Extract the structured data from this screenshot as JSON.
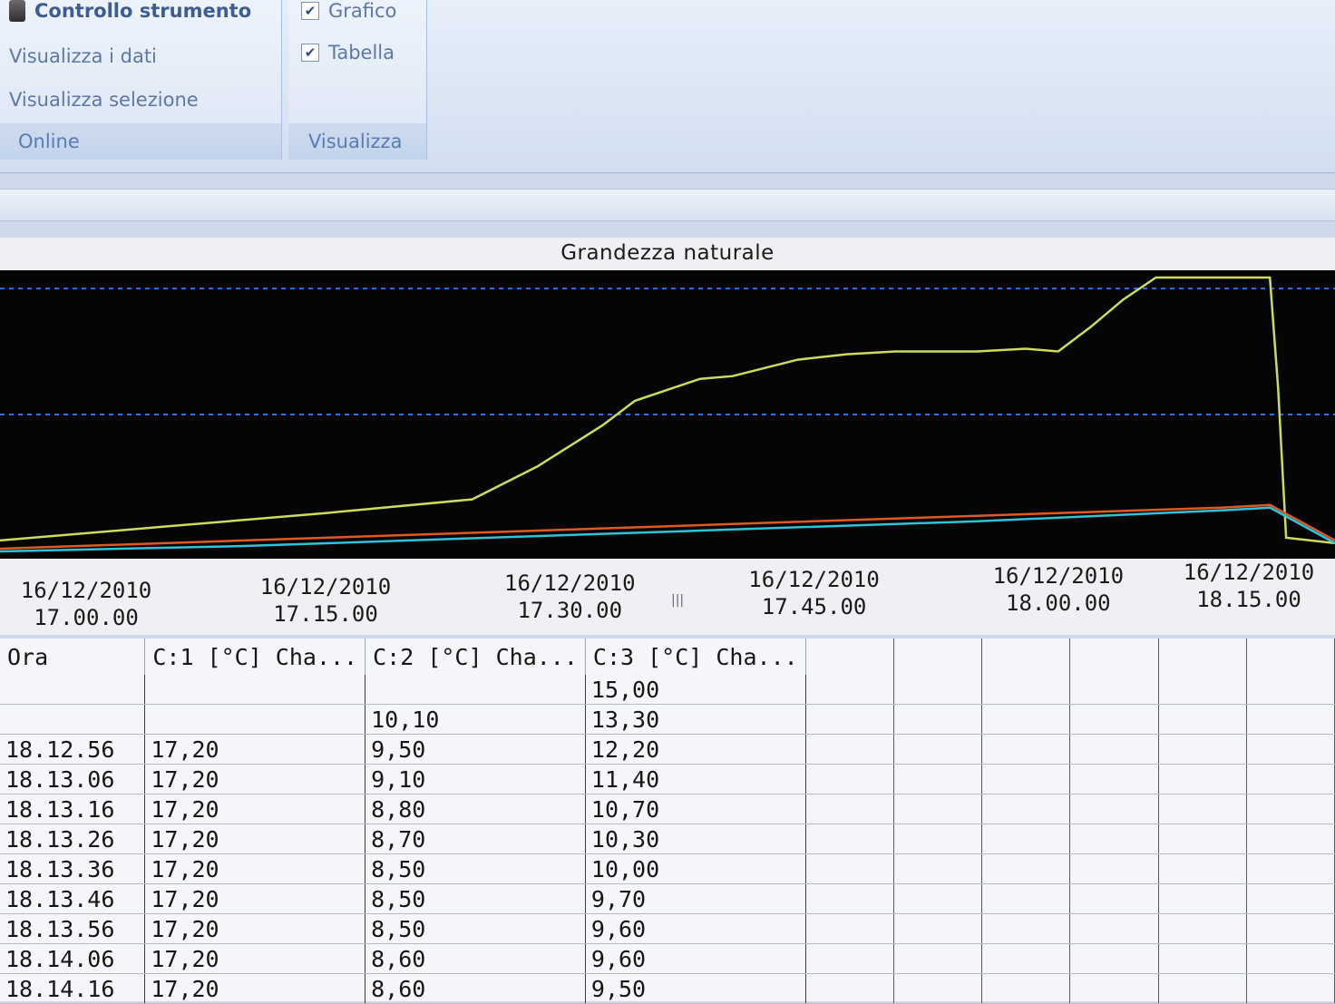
{
  "ribbon": {
    "online_group": {
      "items": [
        {
          "label": "Controllo strumento",
          "icon": "device-icon"
        },
        {
          "label": "Visualizza i dati"
        },
        {
          "label": "Visualizza selezione"
        }
      ],
      "group_label": "Online"
    },
    "view_group": {
      "checkboxes": [
        {
          "label": "Grafico",
          "checked": true
        },
        {
          "label": "Tabella",
          "checked": true
        }
      ],
      "group_label": "Visualizza"
    }
  },
  "chart": {
    "title": "Grandezza naturale"
  },
  "chart_data": {
    "type": "line",
    "title": "Grandezza naturale",
    "x_tick_labels": [
      {
        "date": "16/12/2010",
        "time": "17.00.00"
      },
      {
        "date": "16/12/2010",
        "time": "17.15.00"
      },
      {
        "date": "16/12/2010",
        "time": "17.30.00"
      },
      {
        "date": "16/12/2010",
        "time": "17.45.00"
      },
      {
        "date": "16/12/2010",
        "time": "18.00.00"
      },
      {
        "date": "16/12/2010",
        "time": "18.15.00"
      }
    ],
    "x_unit": "minutes after 16/12/2010 17.00.00",
    "xlim": [
      -5,
      77
    ],
    "ylim": [
      0,
      100
    ],
    "reference_lines": [
      96,
      50
    ],
    "series": [
      {
        "color": "#cddc5a",
        "x": [
          -5,
          5,
          15,
          24,
          28,
          32,
          34,
          36,
          38,
          40,
          44,
          47,
          50,
          52,
          55,
          58,
          60,
          62,
          64,
          66,
          70,
          73,
          73.5,
          74,
          77
        ],
        "y": [
          4,
          9,
          14,
          19,
          31,
          46,
          55,
          59,
          63,
          64,
          70,
          72,
          73,
          73,
          73,
          74,
          73,
          82,
          92,
          100,
          100,
          100,
          60,
          5,
          3
        ]
      },
      {
        "color": "#e05a20",
        "x": [
          -5,
          10,
          25,
          40,
          55,
          70,
          73,
          77
        ],
        "y": [
          1,
          4,
          7,
          10,
          13,
          16,
          17,
          4
        ]
      },
      {
        "color": "#2ec3d8",
        "x": [
          -5,
          10,
          25,
          40,
          55,
          70,
          73,
          77
        ],
        "y": [
          0,
          2,
          5,
          8,
          11,
          15,
          16,
          3
        ]
      }
    ]
  },
  "table": {
    "headers": [
      "Ora",
      "C:1 [°C] Cha...",
      "C:2 [°C] Cha...",
      "C:3 [°C] Cha..."
    ],
    "rows": [
      [
        "",
        "",
        "",
        "15,00"
      ],
      [
        "",
        "",
        "10,10",
        "13,30"
      ],
      [
        "18.12.56",
        "17,20",
        "9,50",
        "12,20"
      ],
      [
        "18.13.06",
        "17,20",
        "9,10",
        "11,40"
      ],
      [
        "18.13.16",
        "17,20",
        "8,80",
        "10,70"
      ],
      [
        "18.13.26",
        "17,20",
        "8,70",
        "10,30"
      ],
      [
        "18.13.36",
        "17,20",
        "8,50",
        "10,00"
      ],
      [
        "18.13.46",
        "17,20",
        "8,50",
        "9,70"
      ],
      [
        "18.13.56",
        "17,20",
        "8,50",
        "9,60"
      ],
      [
        "18.14.06",
        "17,20",
        "8,60",
        "9,60"
      ],
      [
        "18.14.16",
        "17,20",
        "8,60",
        "9,50"
      ]
    ]
  }
}
